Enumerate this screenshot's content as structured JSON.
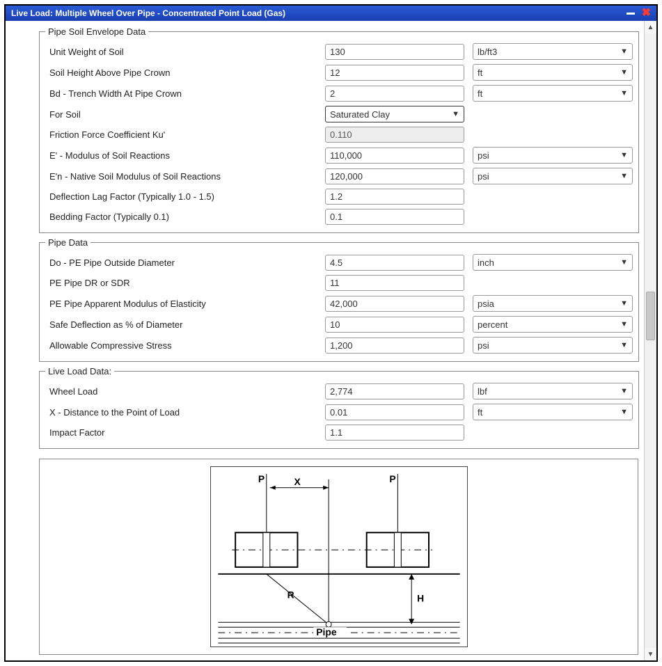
{
  "window": {
    "title": "Live Load: Multiple Wheel Over Pipe - Concentrated Point Load (Gas)"
  },
  "groups": {
    "soil": {
      "legend": "Pipe Soil Envelope Data",
      "unit_weight_label": "Unit Weight of Soil",
      "unit_weight_value": "130",
      "unit_weight_unit": "lb/ft3",
      "soil_height_label": "Soil Height Above Pipe Crown",
      "soil_height_value": "12",
      "soil_height_unit": "ft",
      "bd_label": "Bd - Trench Width At Pipe Crown",
      "bd_value": "2",
      "bd_unit": "ft",
      "for_soil_label": "For Soil",
      "for_soil_value": "Saturated Clay",
      "ku_label": "Friction Force Coefficient Ku'",
      "ku_value": "0.110",
      "eprime_label": "E' - Modulus of Soil Reactions",
      "eprime_value": "110,000",
      "eprime_unit": "psi",
      "en_label": "E'n - Native Soil Modulus of Soil Reactions",
      "en_value": "120,000",
      "en_unit": "psi",
      "lag_label": "Deflection Lag Factor (Typically 1.0 - 1.5)",
      "lag_value": "1.2",
      "bedding_label": "Bedding Factor (Typically 0.1)",
      "bedding_value": "0.1"
    },
    "pipe": {
      "legend": "Pipe Data",
      "do_label": "Do - PE Pipe Outside Diameter",
      "do_value": "4.5",
      "do_unit": "inch",
      "dr_label": "PE Pipe DR or SDR",
      "dr_value": "11",
      "moe_label": "PE Pipe Apparent Modulus of Elasticity",
      "moe_value": "42,000",
      "moe_unit": "psia",
      "deflect_label": "Safe Deflection as % of Diameter",
      "deflect_value": "10",
      "deflect_unit": "percent",
      "comp_label": "Allowable Compressive Stress",
      "comp_value": "1,200",
      "comp_unit": "psi"
    },
    "live": {
      "legend": "Live Load Data:",
      "wheel_label": "Wheel Load",
      "wheel_value": "2,774",
      "wheel_unit": "lbf",
      "x_label": "X - Distance to the Point of Load",
      "x_value": "0.01",
      "x_unit": "ft",
      "impact_label": "Impact Factor",
      "impact_value": "1.1"
    }
  },
  "diagram": {
    "p1": "P",
    "p2": "P",
    "x": "X",
    "r": "R",
    "h": "H",
    "pipe": "Pipe"
  }
}
